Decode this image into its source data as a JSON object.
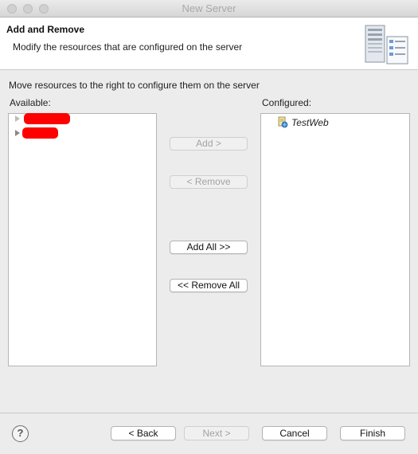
{
  "window": {
    "title": "New Server"
  },
  "banner": {
    "title": "Add and Remove",
    "description": "Modify the resources that are configured on the server",
    "icon": "server-icon"
  },
  "instruction": "Move resources to the right to configure them on the server",
  "available": {
    "label": "Available:",
    "items": [
      {
        "name": "",
        "redacted": true
      },
      {
        "name": "",
        "redacted": true
      }
    ]
  },
  "configured": {
    "label": "Configured:",
    "items": [
      {
        "name": "TestWeb",
        "icon": "web-project-icon"
      }
    ]
  },
  "buttons": {
    "add": "Add >",
    "remove": "< Remove",
    "add_all": "Add All >>",
    "remove_all": "<< Remove All"
  },
  "footer": {
    "back": "< Back",
    "next": "Next >",
    "cancel": "Cancel",
    "finish": "Finish",
    "help_icon": "help-icon"
  },
  "colors": {
    "redaction": "#ff0000",
    "banner_bg": "#ffffff",
    "dialog_bg": "#ececec"
  }
}
